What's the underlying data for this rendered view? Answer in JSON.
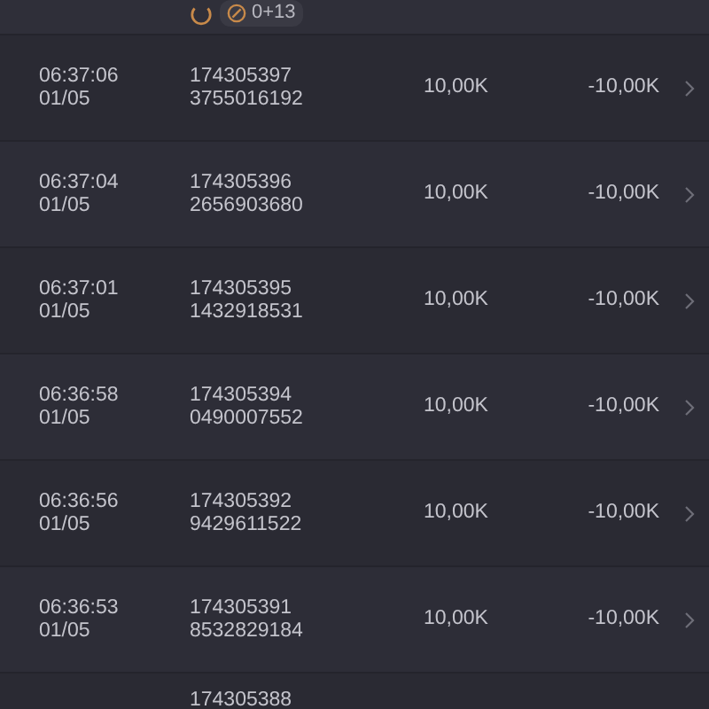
{
  "top_row": {
    "badge": "0+13"
  },
  "rows": [
    {
      "time": "06:37:06",
      "date": "01/05",
      "id": "174305397",
      "ref": "3755016192",
      "amount": "10,00K",
      "result": "-10,00K"
    },
    {
      "time": "06:37:04",
      "date": "01/05",
      "id": "174305396",
      "ref": "2656903680",
      "amount": "10,00K",
      "result": "-10,00K"
    },
    {
      "time": "06:37:01",
      "date": "01/05",
      "id": "174305395",
      "ref": "1432918531",
      "amount": "10,00K",
      "result": "-10,00K"
    },
    {
      "time": "06:36:58",
      "date": "01/05",
      "id": "174305394",
      "ref": "0490007552",
      "amount": "10,00K",
      "result": "-10,00K"
    },
    {
      "time": "06:36:56",
      "date": "01/05",
      "id": "174305392",
      "ref": "9429611522",
      "amount": "10,00K",
      "result": "-10,00K"
    },
    {
      "time": "06:36:53",
      "date": "01/05",
      "id": "174305391",
      "ref": "8532829184",
      "amount": "10,00K",
      "result": "-10,00K"
    }
  ],
  "partial_row": {
    "id": "174305388"
  }
}
